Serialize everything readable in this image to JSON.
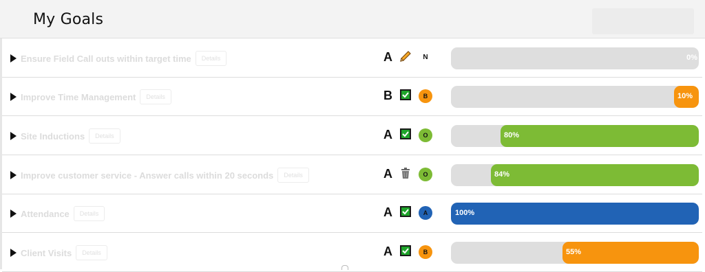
{
  "header": {
    "title": "My Goals"
  },
  "tag_label": "Details",
  "colors": {
    "orange": "#f7940e",
    "green": "#7dbb35",
    "blue": "#2163b5",
    "track": "#dedede"
  },
  "goals": [
    {
      "name": "Ensure Field Call outs within target time",
      "grade": "A",
      "status_icon": "pencil-icon",
      "badge": "N",
      "progress_label": "0%",
      "progress": 0,
      "color": "#dedede"
    },
    {
      "name": "Improve Time Management",
      "grade": "B",
      "status_icon": "check-icon",
      "badge": "B",
      "progress_label": "10%",
      "progress": 0.1,
      "color": "#f7940e"
    },
    {
      "name": "Site Inductions",
      "grade": "A",
      "status_icon": "check-icon",
      "badge": "O",
      "progress_label": "80%",
      "progress": 0.8,
      "color": "#7dbb35"
    },
    {
      "name": "Improve customer service - Answer calls within 20 seconds",
      "grade": "A",
      "status_icon": "trash-icon",
      "badge": "O",
      "progress_label": "84%",
      "progress": 0.84,
      "color": "#7dbb35"
    },
    {
      "name": "Attendance",
      "grade": "A",
      "status_icon": "check-icon",
      "badge": "A",
      "progress_label": "100%",
      "progress": 1.0,
      "color": "#2163b5"
    },
    {
      "name": "Client Visits",
      "grade": "A",
      "status_icon": "check-icon",
      "badge": "B",
      "progress_label": "55%",
      "progress": 0.55,
      "color": "#f7940e"
    }
  ]
}
